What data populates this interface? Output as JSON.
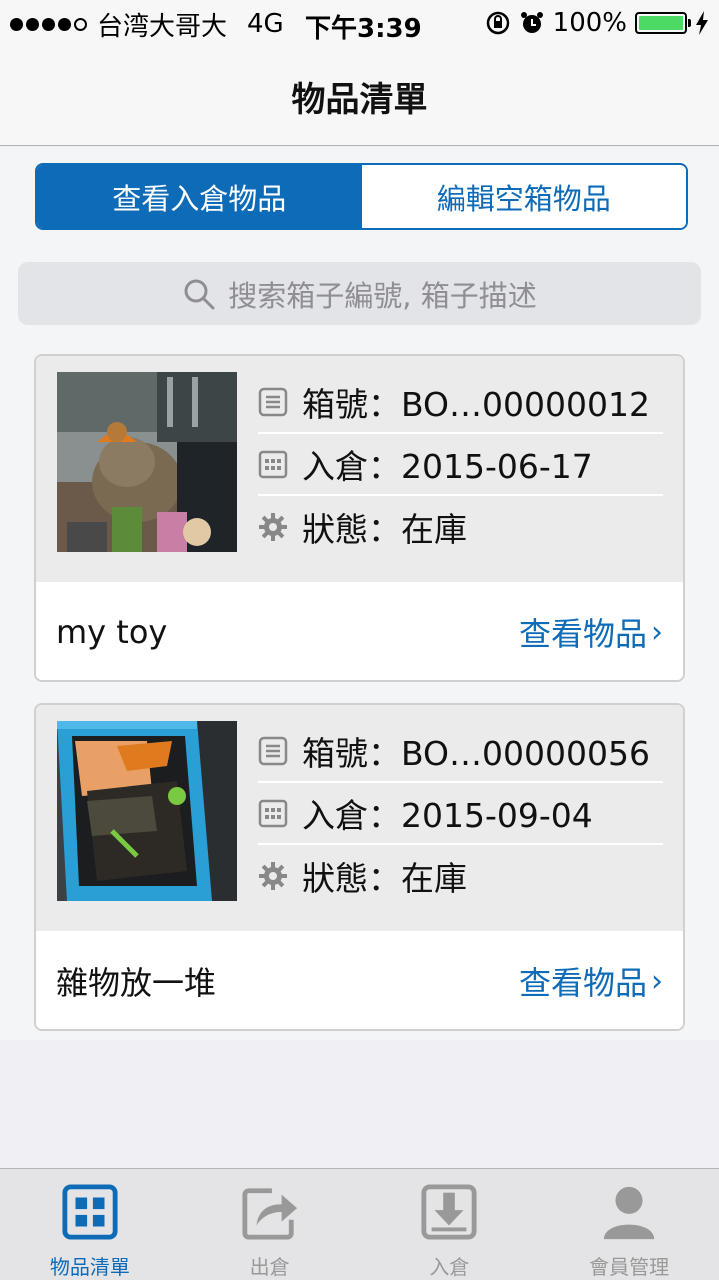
{
  "status_bar": {
    "carrier": "台湾大哥大",
    "network": "4G",
    "time": "下午3:39",
    "battery": "100%",
    "battery_color": "#4cd964"
  },
  "nav": {
    "title": "物品清單"
  },
  "segment": {
    "items": [
      {
        "label": "查看入倉物品",
        "active": true
      },
      {
        "label": "編輯空箱物品",
        "active": false
      }
    ]
  },
  "search": {
    "placeholder": "搜索箱子編號, 箱子描述"
  },
  "cards": [
    {
      "box_no": "箱號：BO…00000012",
      "stored": "入倉：2015-06-17",
      "status": "狀態：在庫",
      "name": "my toy",
      "link": "查看物品"
    },
    {
      "box_no": "箱號：BO…00000056",
      "stored": "入倉：2015-09-04",
      "status": "狀態：在庫",
      "name": "雜物放一堆",
      "link": "查看物品"
    }
  ],
  "tabs": [
    {
      "label": "物品清單",
      "icon": "grid-icon",
      "active": true
    },
    {
      "label": "出倉",
      "icon": "share-out-icon",
      "active": false
    },
    {
      "label": "入倉",
      "icon": "download-in-icon",
      "active": false
    },
    {
      "label": "會員管理",
      "icon": "person-icon",
      "active": false
    }
  ],
  "colors": {
    "accent": "#0e6bb8",
    "inactive": "#999999"
  }
}
